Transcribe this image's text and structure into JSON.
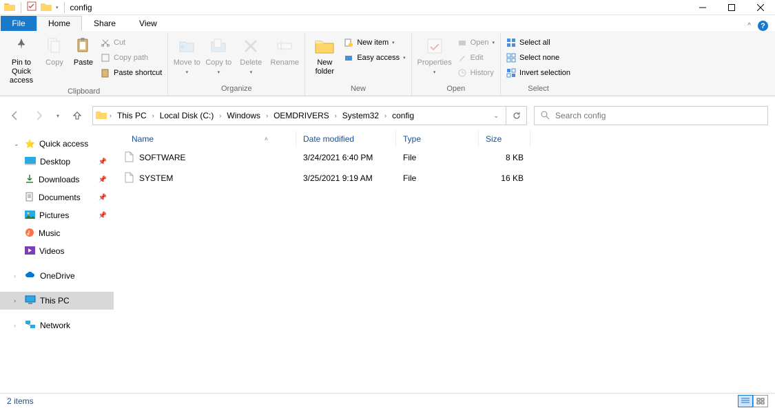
{
  "window": {
    "title": "config"
  },
  "tabs": {
    "file": "File",
    "home": "Home",
    "share": "Share",
    "view": "View"
  },
  "ribbon": {
    "clipboard": {
      "label": "Clipboard",
      "pin": "Pin to Quick access",
      "copy": "Copy",
      "paste": "Paste",
      "cut": "Cut",
      "copypath": "Copy path",
      "pasteshort": "Paste shortcut"
    },
    "organize": {
      "label": "Organize",
      "moveto": "Move to",
      "copyto": "Copy to",
      "delete": "Delete",
      "rename": "Rename"
    },
    "new": {
      "label": "New",
      "newfolder": "New folder",
      "newitem": "New item",
      "easyaccess": "Easy access"
    },
    "open": {
      "label": "Open",
      "properties": "Properties",
      "open": "Open",
      "edit": "Edit",
      "history": "History"
    },
    "select": {
      "label": "Select",
      "selectall": "Select all",
      "selectnone": "Select none",
      "invert": "Invert selection"
    }
  },
  "breadcrumb": [
    "This PC",
    "Local Disk (C:)",
    "Windows",
    "OEMDRIVERS",
    "System32",
    "config"
  ],
  "search": {
    "placeholder": "Search config"
  },
  "navpane": {
    "quickaccess": "Quick access",
    "desktop": "Desktop",
    "downloads": "Downloads",
    "documents": "Documents",
    "pictures": "Pictures",
    "music": "Music",
    "videos": "Videos",
    "onedrive": "OneDrive",
    "thispc": "This PC",
    "network": "Network"
  },
  "columns": {
    "name": "Name",
    "date": "Date modified",
    "type": "Type",
    "size": "Size"
  },
  "files": [
    {
      "name": "SOFTWARE",
      "date": "3/24/2021 6:40 PM",
      "type": "File",
      "size": "8 KB"
    },
    {
      "name": "SYSTEM",
      "date": "3/25/2021 9:19 AM",
      "type": "File",
      "size": "16 KB"
    }
  ],
  "status": {
    "count": "2 items"
  }
}
